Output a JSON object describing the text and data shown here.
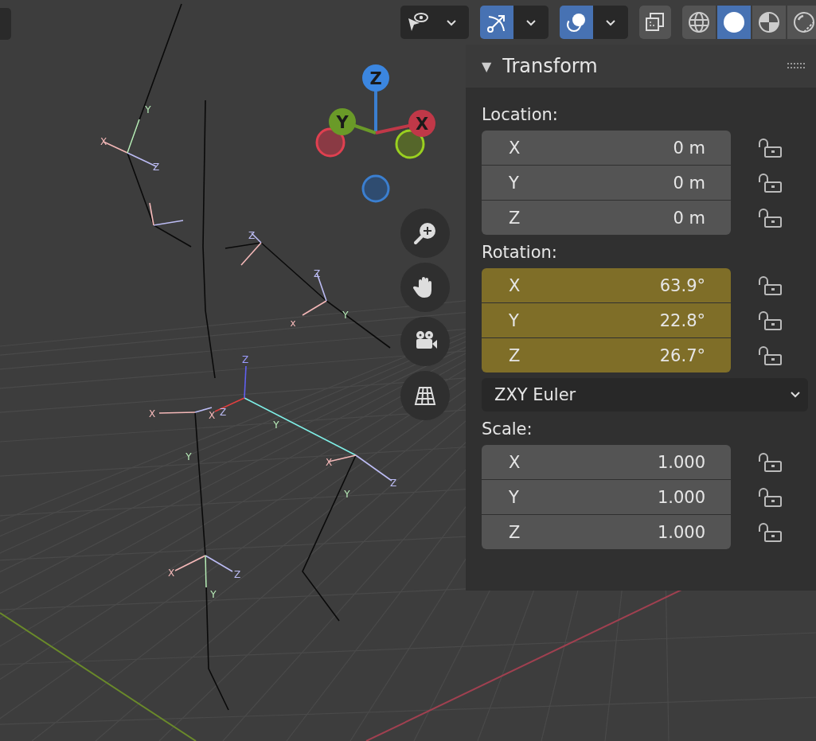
{
  "toolbar": {
    "toggles": [
      {
        "kind": "selectability",
        "selected": false
      },
      {
        "kind": "gizmos",
        "selected": true
      },
      {
        "kind": "overlays",
        "selected": true
      },
      {
        "kind": "xray",
        "selected": false
      }
    ],
    "shading": [
      {
        "kind": "wireframe",
        "selected": false
      },
      {
        "kind": "solid",
        "selected": true
      },
      {
        "kind": "material",
        "selected": false
      },
      {
        "kind": "rendered",
        "selected": false
      }
    ]
  },
  "axis_gizmo": {
    "labels": [
      "Z",
      "Y",
      "X"
    ]
  },
  "navigation": [
    {
      "kind": "zoom"
    },
    {
      "kind": "pan"
    },
    {
      "kind": "camera"
    },
    {
      "kind": "ortho"
    }
  ],
  "armature_labels": [
    {
      "text": "Y",
      "color": "#b8ecb8"
    },
    {
      "text": "X",
      "color": "#f4b8b8"
    },
    {
      "text": "Z",
      "color": "#bcbcf4"
    },
    {
      "text": "Z",
      "color": "#bcbcf4"
    },
    {
      "text": "Z",
      "color": "#bcbcf4"
    },
    {
      "text": "x",
      "color": "#f4b8b8"
    },
    {
      "text": "Y",
      "color": "#b8ecb8"
    },
    {
      "text": "Z",
      "color": "#9c9cff"
    },
    {
      "text": "X",
      "color": "#f4b8b8"
    },
    {
      "text": "X",
      "color": "#f4b8b8"
    },
    {
      "text": "Z",
      "color": "#bcbcf4"
    },
    {
      "text": "Y",
      "color": "#b8ecb8"
    },
    {
      "text": "Y",
      "color": "#b8ecb8"
    },
    {
      "text": "X",
      "color": "#f4b8b8"
    },
    {
      "text": "Z",
      "color": "#bcbcf4"
    },
    {
      "text": "Y",
      "color": "#b8ecb8"
    },
    {
      "text": "X",
      "color": "#f4b8b8"
    },
    {
      "text": "Z",
      "color": "#bcbcf4"
    },
    {
      "text": "Y",
      "color": "#b8ecb8"
    }
  ],
  "transform_panel": {
    "toggle": "▼",
    "title": "Transform",
    "sections": [
      {
        "label": "Location:",
        "fields": [
          {
            "axis": "X",
            "value": "0 m",
            "keyframed": false,
            "locked": false
          },
          {
            "axis": "Y",
            "value": "0 m",
            "keyframed": false,
            "locked": false
          },
          {
            "axis": "Z",
            "value": "0 m",
            "keyframed": false,
            "locked": false
          }
        ]
      },
      {
        "label": "Rotation:",
        "fields": [
          {
            "axis": "X",
            "value": "63.9°",
            "keyframed": true,
            "locked": false
          },
          {
            "axis": "Y",
            "value": "22.8°",
            "keyframed": true,
            "locked": false
          },
          {
            "axis": "Z",
            "value": "26.7°",
            "keyframed": true,
            "locked": false
          }
        ],
        "mode": "ZXY Euler"
      },
      {
        "label": "Scale:",
        "fields": [
          {
            "axis": "X",
            "value": "1.000",
            "keyframed": false,
            "locked": false
          },
          {
            "axis": "Y",
            "value": "1.000",
            "keyframed": false,
            "locked": false
          },
          {
            "axis": "Z",
            "value": "1.000",
            "keyframed": false,
            "locked": false
          }
        ]
      }
    ]
  }
}
